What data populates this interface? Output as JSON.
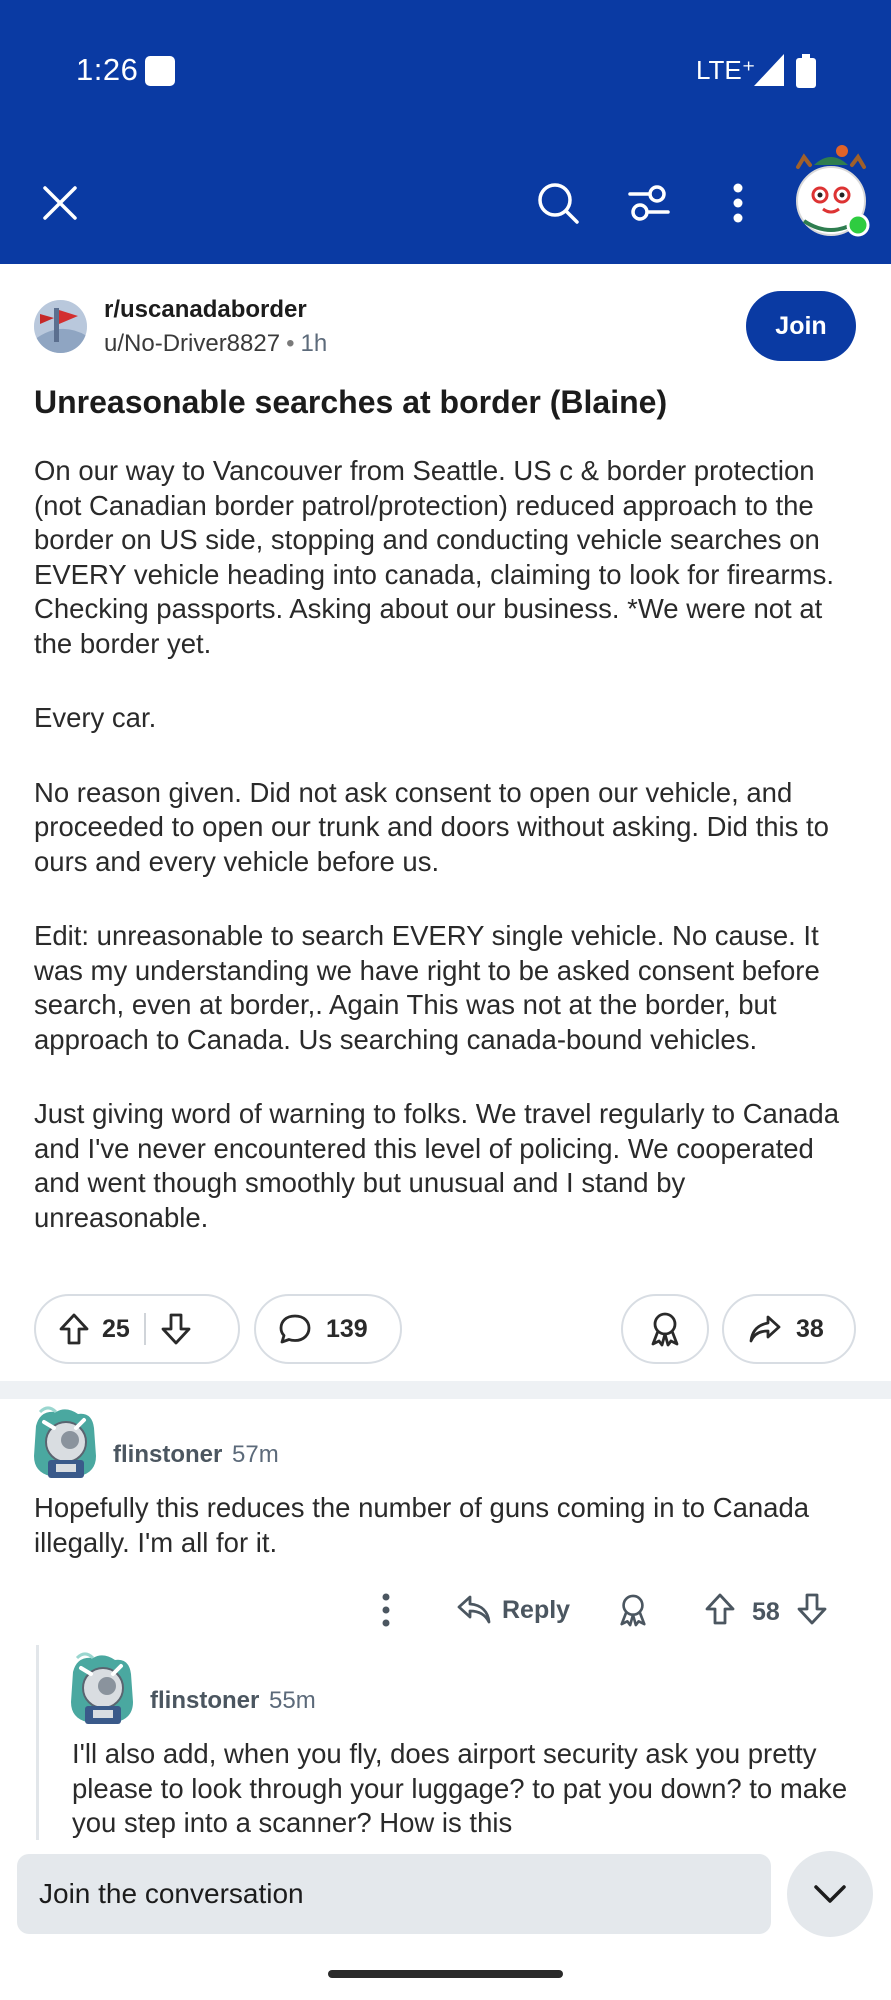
{
  "status_bar": {
    "time": "1:26",
    "network": "LTE⁺"
  },
  "toolbar": {
    "icons": [
      "close-icon",
      "search-icon",
      "filter-icon",
      "more-vertical-icon",
      "user-avatar"
    ]
  },
  "post": {
    "subreddit": "r/uscanadaborder",
    "author": "u/No-Driver8827",
    "separator": "•",
    "age": "1h",
    "join_label": "Join",
    "title": "Unreasonable searches at border (Blaine)",
    "body": [
      "On our way to Vancouver from Seattle. US c & border protection (not Canadian border patrol/protection) reduced approach to the border on US side, stopping and conducting vehicle searches on EVERY vehicle heading into canada, claiming to look for firearms. Checking passports. Asking about our business. *We were not at the border yet.",
      "Every car.",
      "No reason given. Did not ask consent to open our vehicle, and proceeded to open our trunk and doors without asking. Did this to ours and every vehicle before us.",
      "Edit: unreasonable to search EVERY single vehicle. No cause. It was my understanding we have right to be asked consent before search, even at border,. Again This was not at the border, but approach to Canada. Us searching canada-bound vehicles.",
      "Just giving word of warning to folks. We travel regularly to Canada and I've never encountered this level of policing. We cooperated and went though smoothly but unusual and I stand by unreasonable."
    ],
    "upvotes": "25",
    "comments": "139",
    "shares": "38"
  },
  "comments": [
    {
      "author": "flinstoner",
      "age": "57m",
      "text": "Hopefully this reduces the number of guns coming in to Canada illegally. I'm all for it.",
      "reply_label": "Reply",
      "votes": "58"
    },
    {
      "author": "flinstoner",
      "age": "55m",
      "text": "I'll also add, when you fly, does airport security ask you pretty please to look through your luggage? to pat you down? to make you step into a scanner? How is this"
    }
  ],
  "bottom_bar": {
    "placeholder": "Join the conversation"
  },
  "colors": {
    "header": "#0a3aa3",
    "join_button": "#0a3aa3",
    "text": "#1c1c1c",
    "muted": "#4b5660",
    "input_bg": "#e4e8ec"
  }
}
